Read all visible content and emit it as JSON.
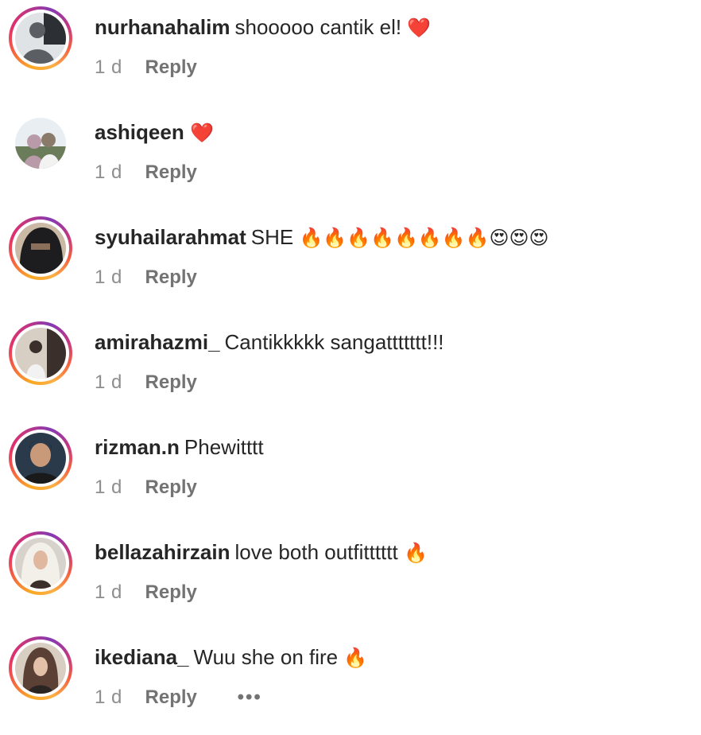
{
  "comments": [
    {
      "username": "nurhanahalim",
      "text": "shooooo cantik el!",
      "emoji": "❤️",
      "time": "1 d",
      "reply_label": "Reply",
      "avatar_colors": [
        "#dfe3e6",
        "#5b5f63",
        "#2c2f33"
      ],
      "story_ring": true
    },
    {
      "username": "ashiqeen",
      "text": "",
      "emoji": "❤️",
      "time": "1 d",
      "reply_label": "Reply",
      "avatar_colors": [
        "#e9eef2",
        "#b99aa8",
        "#6b7c5a"
      ],
      "story_ring": false
    },
    {
      "username": "syuhailarahmat",
      "text": "SHE",
      "emoji": "🔥🔥🔥🔥🔥🔥🔥🔥😍😍😍",
      "time": "1 d",
      "reply_label": "Reply",
      "avatar_colors": [
        "#c9b9a5",
        "#1d1d1f",
        "#8a6f5a"
      ],
      "story_ring": true
    },
    {
      "username": "amirahazmi_",
      "text": "Cantikkkkk sangattttttt!!!",
      "emoji": "",
      "time": "1 d",
      "reply_label": "Reply",
      "avatar_colors": [
        "#d8cfc4",
        "#3a2f2a",
        "#f2f2f2"
      ],
      "story_ring": true
    },
    {
      "username": "rizman.n",
      "text": "Phewitttt",
      "emoji": "",
      "time": "1 d",
      "reply_label": "Reply",
      "avatar_colors": [
        "#2b3a4a",
        "#c89a7a",
        "#1a1a1a"
      ],
      "story_ring": true
    },
    {
      "username": "bellazahirzain",
      "text": "love both outfitttttt",
      "emoji": "🔥",
      "time": "1 d",
      "reply_label": "Reply",
      "avatar_colors": [
        "#d7d2cc",
        "#f3efe9",
        "#3b2f2a"
      ],
      "story_ring": true
    },
    {
      "username": "ikediana_",
      "text": "Wuu she on fire",
      "emoji": "🔥",
      "time": "1 d",
      "reply_label": "Reply",
      "avatar_colors": [
        "#d9cec2",
        "#5a4035",
        "#2a2522"
      ],
      "story_ring": true
    }
  ],
  "more_label": "•••"
}
